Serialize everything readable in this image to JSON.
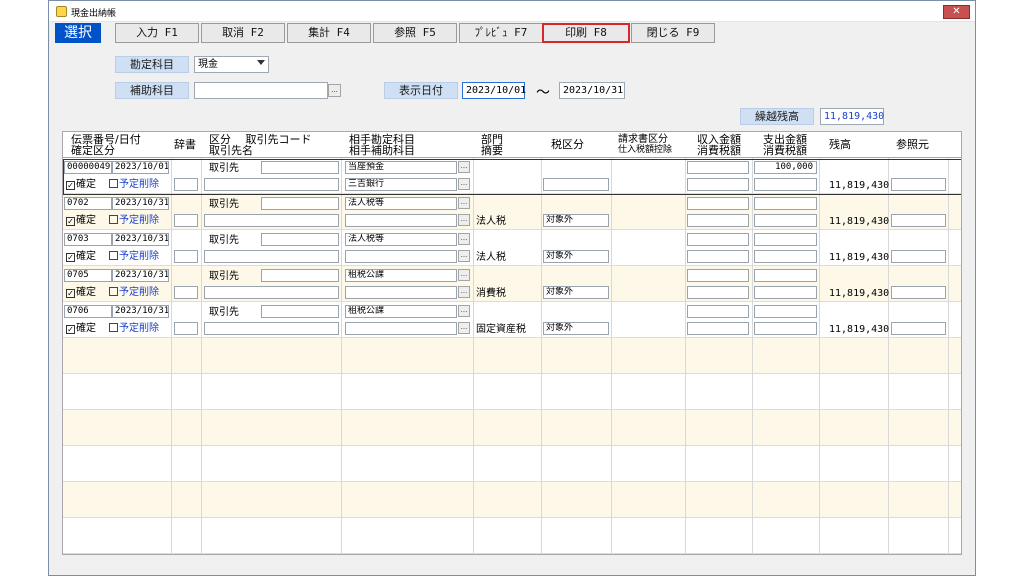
{
  "window": {
    "title": "現金出納帳",
    "close_label": "✕"
  },
  "toolbar": {
    "select_label": "選択",
    "buttons": [
      {
        "label": "入力 F1"
      },
      {
        "label": "取消 F2"
      },
      {
        "label": "集計 F4"
      },
      {
        "label": "参照 F5"
      },
      {
        "label": "ﾌﾟﾚﾋﾞｭ F7"
      },
      {
        "label": "印刷 F8"
      },
      {
        "label": "閉じる F9"
      }
    ]
  },
  "filters": {
    "account_label": "勘定科目",
    "account_value": "現金",
    "sub_account_label": "補助科目",
    "sub_account_value": "",
    "date_label": "表示日付",
    "date_from": "2023/10/01",
    "date_sep": "～",
    "date_to": "2023/10/31",
    "balance_label": "繰越残高",
    "balance_value": "11,819,430",
    "ellipsis": "..."
  },
  "grid": {
    "headers": {
      "c1a": "伝票番号/日付",
      "c1b": "確定区分",
      "c2": "辞書",
      "c3a": "区分　 取引先コード",
      "c3b": "取引先名",
      "c4a": "相手勘定科目",
      "c4b": "相手補助科目",
      "c5a": "部門",
      "c5b": "摘要",
      "c6": "税区分",
      "c7a": "請求書区分",
      "c7b": "仕入税額控除",
      "c8a": "収入金額",
      "c8b": "消費税額",
      "c9a": "支出金額",
      "c9b": "消費税額",
      "c10": "残高",
      "c11": "参照元"
    },
    "confirm_label": "確定",
    "planned_delete_label": "予定削除",
    "rows": [
      {
        "no": "00000049",
        "date": "2023/10/01",
        "kubun": "取引先",
        "account": "当座預金",
        "sub_account": "三吉銀行",
        "memo": "",
        "tax": "",
        "expense": "100,000",
        "balance": "11,819,430"
      },
      {
        "no": "0702",
        "date": "2023/10/31",
        "kubun": "取引先",
        "account": "法人税等",
        "sub_account": "",
        "memo": "法人税",
        "tax": "対象外",
        "expense": "",
        "balance": "11,819,430"
      },
      {
        "no": "0703",
        "date": "2023/10/31",
        "kubun": "取引先",
        "account": "法人税等",
        "sub_account": "",
        "memo": "法人税",
        "tax": "対象外",
        "expense": "",
        "balance": "11,819,430"
      },
      {
        "no": "0705",
        "date": "2023/10/31",
        "kubun": "取引先",
        "account": "租税公課",
        "sub_account": "",
        "memo": "消費税",
        "tax": "対象外",
        "expense": "",
        "balance": "11,819,430"
      },
      {
        "no": "0706",
        "date": "2023/10/31",
        "kubun": "取引先",
        "account": "租税公課",
        "sub_account": "",
        "memo": "固定資産税",
        "tax": "対象外",
        "expense": "",
        "balance": "11,819,430"
      }
    ]
  }
}
